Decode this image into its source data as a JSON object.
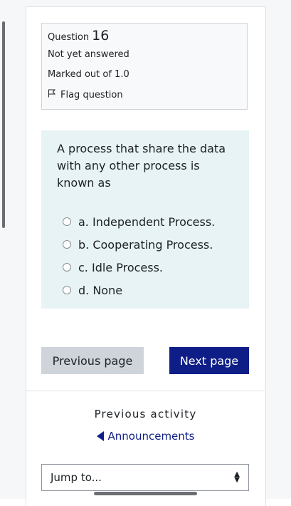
{
  "question": {
    "label": "Question",
    "number": "16",
    "status": "Not yet answered",
    "marks": "Marked out of 1.0",
    "flag_label": "Flag question"
  },
  "prompt": "A process that share the data with any other process is known as",
  "options": [
    {
      "label": "a. Independent Process."
    },
    {
      "label": "b. Cooperating Process."
    },
    {
      "label": "c. Idle Process."
    },
    {
      "label": "d. None"
    }
  ],
  "nav": {
    "previous_label": "Previous page",
    "next_label": "Next page"
  },
  "activity": {
    "heading": "Previous activity",
    "link_label": "Announcements"
  },
  "jump": {
    "value": "Jump to..."
  },
  "colors": {
    "primary": "#0f1e87",
    "question_bg": "#e7f3f5",
    "secondary_button": "#ced4da"
  }
}
